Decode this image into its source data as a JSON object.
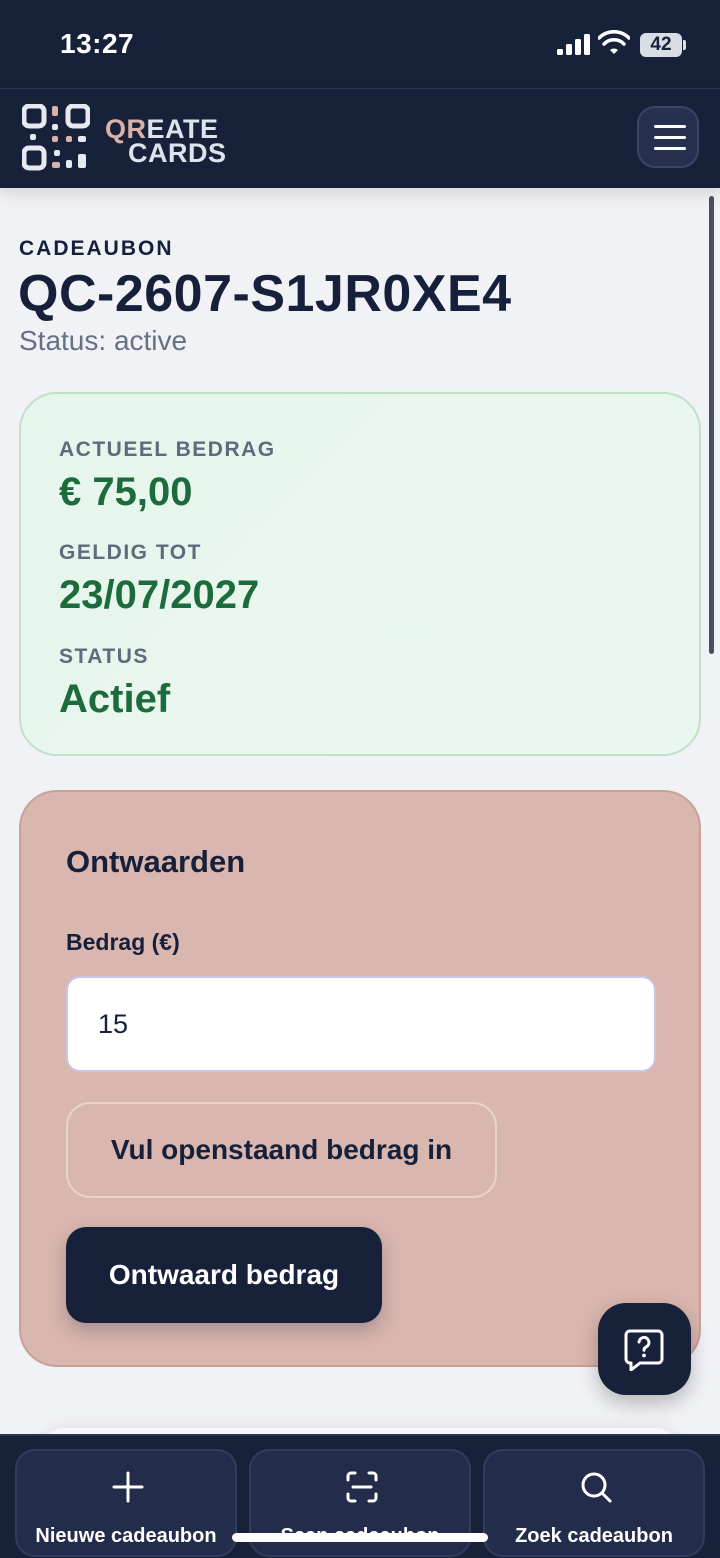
{
  "status_bar": {
    "time": "13:27",
    "battery": "42"
  },
  "header": {
    "logo_word1_accent": "QR",
    "logo_word1_rest": "EATE",
    "logo_word2": "CARDS"
  },
  "voucher": {
    "eyebrow": "CADEAUBON",
    "code": "QC-2607-S1JR0XE4",
    "status_line": "Status: active"
  },
  "summary": {
    "amount_label": "ACTUEEL BEDRAG",
    "amount_value": "€ 75,00",
    "valid_label": "GELDIG TOT",
    "valid_value": "23/07/2027",
    "status_label": "STATUS",
    "status_value": "Actief"
  },
  "redeem": {
    "title": "Ontwaarden",
    "field_label": "Bedrag (€)",
    "amount_value": "15",
    "fill_button": "Vul openstaand bedrag in",
    "submit_button": "Ontwaard bedrag"
  },
  "bottom_nav": {
    "items": [
      {
        "label": "Nieuwe cadeaubon",
        "icon": "plus-icon"
      },
      {
        "label": "Scan cadeaubon",
        "icon": "scan-icon"
      },
      {
        "label": "Zoek cadeaubon",
        "icon": "search-icon"
      }
    ]
  },
  "colors": {
    "navy": "#17213a",
    "success_green": "#1c6b3c",
    "success_bg": "#e6f6ec",
    "rose_card": "#d9b6ae",
    "logo_accent": "#d9b3a9"
  }
}
